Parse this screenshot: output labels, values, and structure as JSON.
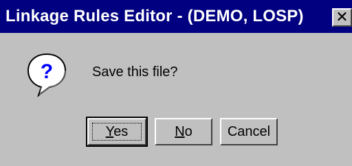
{
  "window": {
    "title": "Linkage Rules Editor - (DEMO, LOSP)",
    "close_glyph": "✕"
  },
  "dialog": {
    "icon": "question-icon",
    "message": "Save this file?"
  },
  "buttons": {
    "yes": {
      "accel": "Y",
      "rest": "es"
    },
    "no": {
      "accel": "N",
      "rest": "o"
    },
    "cancel": {
      "label": "Cancel"
    }
  },
  "colors": {
    "titlebar": "#000080",
    "face": "#c0c0c0",
    "icon_blue": "#0000ff"
  }
}
